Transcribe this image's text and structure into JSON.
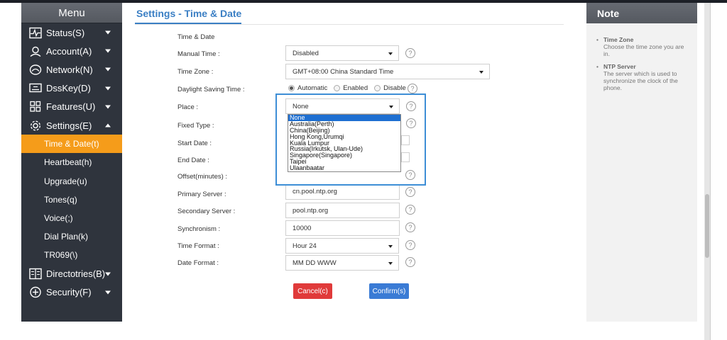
{
  "sidebar": {
    "header": "Menu",
    "items_top": [
      {
        "label": "Status(S)",
        "icon": "pulse-icon"
      },
      {
        "label": "Account(A)",
        "icon": "user-icon"
      },
      {
        "label": "Network(N)",
        "icon": "network-icon"
      },
      {
        "label": "DssKey(D)",
        "icon": "keyboard-icon"
      },
      {
        "label": "Features(U)",
        "icon": "grid-icon"
      },
      {
        "label": "Settings(E)",
        "icon": "gear-icon"
      }
    ],
    "sub_items": [
      "Time & Date(t)",
      "Heartbeat(h)",
      "Upgrade(u)",
      "Tones(q)",
      "Voice(;)",
      "Dial Plan(k)",
      "TR069(\\)"
    ],
    "items_bottom": [
      {
        "label": "Directotries(B)",
        "icon": "book-icon"
      },
      {
        "label": "Security(F)",
        "icon": "shield-plus-icon"
      }
    ],
    "active_color": "#f59c1a"
  },
  "main": {
    "title": "Settings - Time & Date",
    "section_label": "Time & Date",
    "labels": {
      "manual_time": "Manual Time :",
      "time_zone": "Time Zone :",
      "daylight": "Daylight Saving Time :",
      "place": "Place :",
      "fixed_type": "Fixed Type :",
      "start_date": "Start Date :",
      "end_date": "End Date :",
      "offset": "Offset(minutes) :",
      "primary_server": "Primary Server :",
      "secondary_server": "Secondary Server :",
      "synchronism": "Synchronism :",
      "time_format": "Time Format :",
      "date_format": "Date Format :"
    },
    "values": {
      "manual_time": "Disabled",
      "time_zone": "GMT+08:00 China Standard Time",
      "place": "None",
      "primary_server": "cn.pool.ntp.org",
      "secondary_server": "pool.ntp.org",
      "synchronism": "10000",
      "time_format": "Hour 24",
      "date_format": "MM DD WWW"
    },
    "daylight_options": [
      "Automatic",
      "Enabled",
      "Disable"
    ],
    "daylight_selected": "Automatic",
    "place_options": [
      "None",
      "Australia(Perth)",
      "China(Beijing)",
      "Hong Kong,Urumqi",
      "Kuala Lumpur",
      "Russia(Irkutsk, Ulan-Ude)",
      "Singapore(Singapore)",
      "Taipei",
      "Ulaanbaatar"
    ],
    "help_glyph": "?",
    "buttons": {
      "cancel": "Cancel(c)",
      "confirm": "Confirm(s)"
    },
    "accent_color": "#3b7fc4"
  },
  "note": {
    "header": "Note",
    "items": [
      {
        "title": "Time Zone",
        "text": "Choose the time zone you are in."
      },
      {
        "title": "NTP Server",
        "text": "The server which is used to synchronize the clock of the phone."
      }
    ]
  }
}
